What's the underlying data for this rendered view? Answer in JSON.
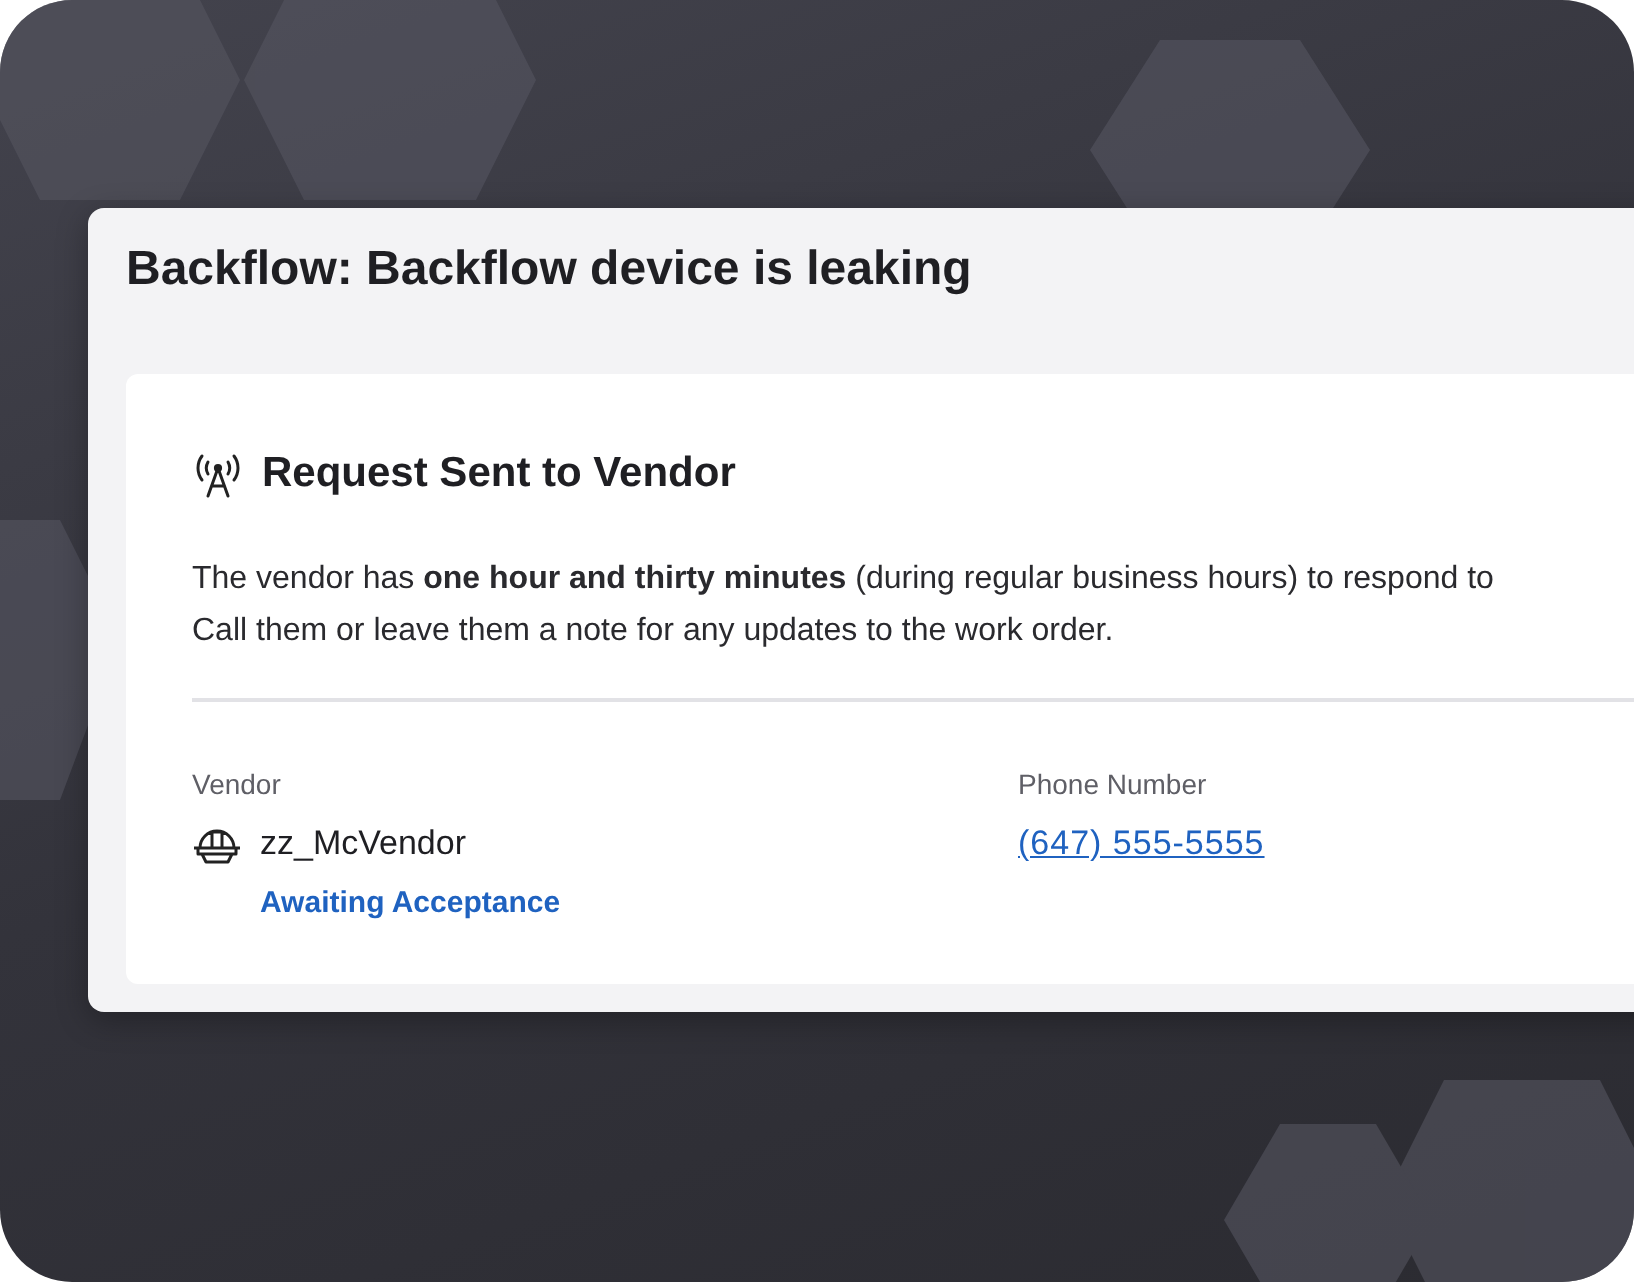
{
  "title": "Backflow: Backflow device is leaking",
  "status_card": {
    "heading": "Request Sent to Vendor",
    "message": "The vendor has **one hour and thirty minutes** (during regular business hours) to respond to\nCall them or leave them a note for any updates to the work order.",
    "vendor": {
      "label": "Vendor",
      "name": "zz_McVendor",
      "status": "Awaiting Acceptance"
    },
    "phone": {
      "label": "Phone Number",
      "value": "(647) 555-5555"
    }
  }
}
